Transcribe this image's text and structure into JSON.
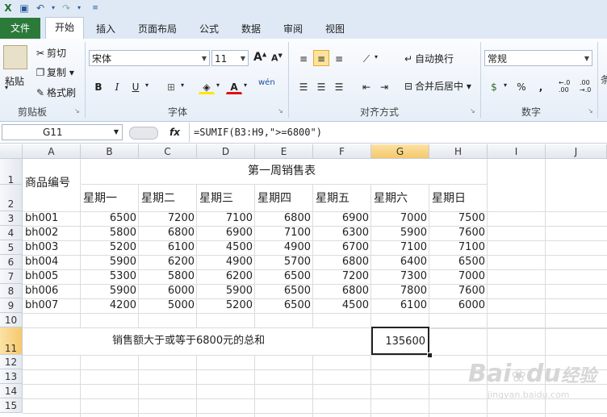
{
  "qat": {
    "save_icon": "save-icon",
    "undo_icon": "undo-icon",
    "redo_icon": "redo-icon"
  },
  "tabs": [
    "文件",
    "开始",
    "插入",
    "页面布局",
    "公式",
    "数据",
    "审阅",
    "视图"
  ],
  "clipboard": {
    "paste": "粘贴",
    "cut": "剪切",
    "copy": "复制 ▾",
    "format_painter": "格式刷",
    "group": "剪贴板"
  },
  "font": {
    "name": "宋体",
    "size": "11",
    "grow": "A",
    "shrink": "A",
    "bold": "B",
    "italic": "I",
    "underline": "U",
    "group": "字体",
    "wen": "wén"
  },
  "alignment": {
    "wrap": "自动换行",
    "merge": "合并后居中 ▾",
    "group": "对齐方式"
  },
  "number": {
    "format": "常规",
    "percent": "%",
    "comma": ",",
    "group": "数字"
  },
  "formula_bar": {
    "cell_ref": "G11",
    "fx": "fx",
    "formula": "=SUMIF(B3:H9,\">=6800\")"
  },
  "columns": [
    "A",
    "B",
    "C",
    "D",
    "E",
    "F",
    "G",
    "H",
    "I",
    "J"
  ],
  "rows": [
    "1",
    "2",
    "3",
    "4",
    "5",
    "6",
    "7",
    "8",
    "9",
    "10",
    "11",
    "12",
    "13",
    "14",
    "15"
  ],
  "sheet": {
    "title": "第一周销售表",
    "a_header": "商品编号",
    "days": [
      "星期一",
      "星期二",
      "星期三",
      "星期四",
      "星期五",
      "星期六",
      "星期日"
    ],
    "data": [
      [
        "bh001",
        "6500",
        "7200",
        "7100",
        "6800",
        "6900",
        "7000",
        "7500"
      ],
      [
        "bh002",
        "5800",
        "6800",
        "6900",
        "7100",
        "6300",
        "5900",
        "7600"
      ],
      [
        "bh003",
        "5200",
        "6100",
        "4500",
        "4900",
        "6700",
        "7100",
        "7100"
      ],
      [
        "bh004",
        "5900",
        "6200",
        "4900",
        "5700",
        "6800",
        "6400",
        "6500"
      ],
      [
        "bh005",
        "5300",
        "5800",
        "6200",
        "6500",
        "7200",
        "7300",
        "7000"
      ],
      [
        "bh006",
        "5900",
        "6000",
        "5900",
        "6500",
        "6800",
        "7800",
        "7600"
      ],
      [
        "bh007",
        "4200",
        "5000",
        "5200",
        "6500",
        "4500",
        "6100",
        "6000"
      ]
    ],
    "summary_label": "销售额大于或等于6800元的总和",
    "summary_value": "135600"
  },
  "watermark": {
    "brand": "Bai",
    "paw": "du",
    "cn": "经验",
    "url": "jingyan.baidu.com"
  }
}
